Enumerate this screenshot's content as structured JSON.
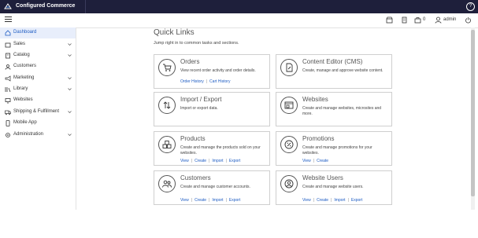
{
  "app": {
    "title": "Configured Commerce"
  },
  "topbar": {
    "help_icon": "help-circle-icon"
  },
  "subbar": {
    "cart_count": "0",
    "admin_label": "admin"
  },
  "sidebar": {
    "items": [
      {
        "label": "Dashboard",
        "icon": "home-icon",
        "active": true,
        "expandable": false
      },
      {
        "label": "Sales",
        "icon": "sales-icon",
        "active": false,
        "expandable": true
      },
      {
        "label": "Catalog",
        "icon": "catalog-icon",
        "active": false,
        "expandable": true
      },
      {
        "label": "Customers",
        "icon": "customers-icon",
        "active": false,
        "expandable": false
      },
      {
        "label": "Marketing",
        "icon": "megaphone-icon",
        "active": false,
        "expandable": true
      },
      {
        "label": "Library",
        "icon": "library-icon",
        "active": false,
        "expandable": true
      },
      {
        "label": "Websites",
        "icon": "monitor-icon",
        "active": false,
        "expandable": false
      },
      {
        "label": "Shipping & Fulfillment",
        "icon": "truck-icon",
        "active": false,
        "expandable": true
      },
      {
        "label": "Mobile App",
        "icon": "mobile-icon",
        "active": false,
        "expandable": false
      },
      {
        "label": "Administration",
        "icon": "gear-icon",
        "active": false,
        "expandable": true
      }
    ]
  },
  "quick_links": {
    "title": "Quick Links",
    "subtitle": "Jump right in to common tasks and sections.",
    "cards": [
      {
        "title": "Orders",
        "desc": "View recent order activity and order details.",
        "links": [
          "Order History",
          "Cart History"
        ]
      },
      {
        "title": "Content Editor (CMS)",
        "desc": "Create, manage and approve website content.",
        "links": []
      },
      {
        "title": "Import / Export",
        "desc": "Import or export data.",
        "links": []
      },
      {
        "title": "Websites",
        "desc": "Create and manage websites, microsites and more.",
        "links": []
      },
      {
        "title": "Products",
        "desc": "Create and manage the products sold on your websites.",
        "links": [
          "View",
          "Create",
          "Import",
          "Export"
        ]
      },
      {
        "title": "Promotions",
        "desc": "Create and manage promotions for your websites.",
        "links": [
          "View",
          "Create"
        ]
      },
      {
        "title": "Customers",
        "desc": "Create and manage customer accounts.",
        "links": [
          "View",
          "Create",
          "Import",
          "Export"
        ]
      },
      {
        "title": "Website Users",
        "desc": "Create and manage website users.",
        "links": [
          "View",
          "Create",
          "Import",
          "Export"
        ]
      }
    ]
  },
  "colors": {
    "topbar": "#1e1f3b",
    "link": "#1c5bc3",
    "active_bg": "#e8eefb"
  }
}
